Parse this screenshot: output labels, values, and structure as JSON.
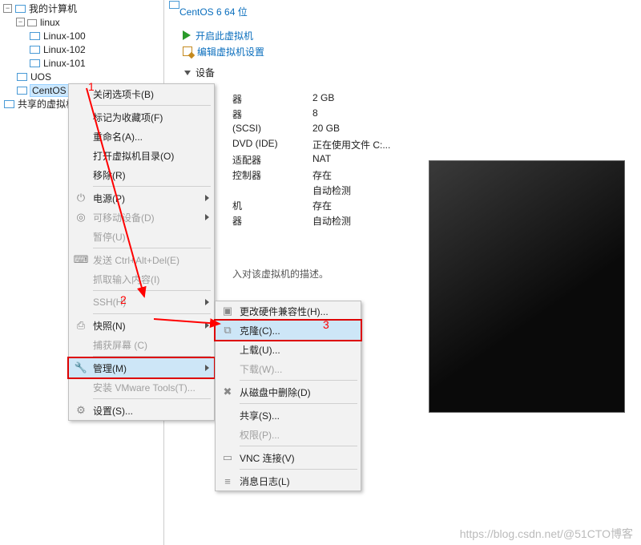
{
  "tree": {
    "root": "我的计算机",
    "folder": "linux",
    "vm100": "Linux-100",
    "vm102": "Linux-102",
    "vm101": "Linux-101",
    "uos": "UOS",
    "centos": "CentOS",
    "shared": "共享的虚拟机"
  },
  "title": "CentOS 6 64 位",
  "actions": {
    "power_on": "开启此虚拟机",
    "edit": "编辑虚拟机设置"
  },
  "devices_header": "设备",
  "specs": [
    {
      "k": "器",
      "v": "2 GB"
    },
    {
      "k": "器",
      "v": "8"
    },
    {
      "k": "(SCSI)",
      "v": "20 GB"
    },
    {
      "k": "DVD (IDE)",
      "v": "正在使用文件 C:..."
    },
    {
      "k": "适配器",
      "v": "NAT"
    },
    {
      "k": "控制器",
      "v": "存在"
    },
    {
      "k": "",
      "v": "自动检测"
    },
    {
      "k": "机",
      "v": "存在"
    },
    {
      "k": "器",
      "v": "自动检测"
    }
  ],
  "description_prompt": "入对该虚拟机的描述。",
  "context_menu": {
    "close_tab": "关闭选项卡(B)",
    "mark_fav": "标记为收藏项(F)",
    "rename": "重命名(A)...",
    "open_dir": "打开虚拟机目录(O)",
    "remove": "移除(R)",
    "power": "电源(P)",
    "removable": "可移动设备(D)",
    "pause": "暂停(U)",
    "send_cad": "发送 Ctrl+Alt+Del(E)",
    "grab_input": "抓取输入内容(I)",
    "ssh": "SSH(H)",
    "snapshot": "快照(N)",
    "capture": "捕获屏幕 (C)",
    "manage": "管理(M)",
    "install_tools": "安装 VMware Tools(T)...",
    "settings": "设置(S)..."
  },
  "submenu": {
    "compat": "更改硬件兼容性(H)...",
    "clone": "克隆(C)...",
    "upload": "上载(U)...",
    "download": "下载(W)...",
    "delete_disk": "从磁盘中删除(D)",
    "share": "共享(S)...",
    "perm": "权限(P)...",
    "vnc": "VNC 连接(V)",
    "log": "消息日志(L)"
  },
  "annotations": {
    "step1": "1",
    "step2": "2",
    "step3": "3"
  },
  "watermark": "https://blog.csdn.net/@51CTO博客"
}
